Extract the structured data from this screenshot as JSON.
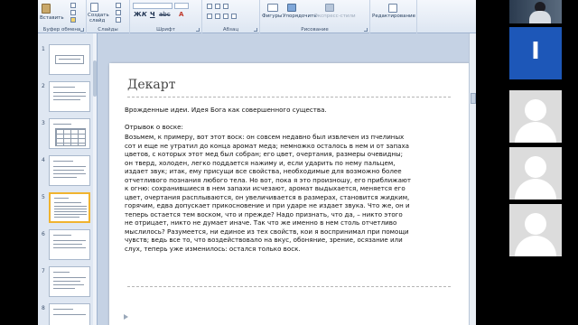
{
  "ribbon": {
    "clipboard": {
      "paste": "Вставить",
      "label": "Буфер обмена"
    },
    "slides": {
      "create": "Создать",
      "create2": "слайд",
      "label": "Слайды"
    },
    "font": {
      "label": "Шрифт"
    },
    "paragraph": {
      "label": "Абзац"
    },
    "drawing": {
      "shapes": "Фигуры",
      "arrange": "Упорядочить",
      "quick_styles": "Экспресс-стили",
      "label": "Рисование"
    },
    "editing": {
      "label": "Редактирование"
    }
  },
  "thumbnails": [
    {
      "num": "1"
    },
    {
      "num": "2"
    },
    {
      "num": "3"
    },
    {
      "num": "4"
    },
    {
      "num": "5"
    },
    {
      "num": "6"
    },
    {
      "num": "7"
    },
    {
      "num": "8"
    }
  ],
  "selected_slide": "5",
  "slide": {
    "title": "Декарт",
    "subtitle": "Врожденные идеи. Идея Бога как совершенного существа.",
    "excerpt_label": "Отрывок о воске:",
    "body": "Возьмем, к примеру, вот этот воск: он совсем недавно был извлечен из пчелиных сот и еще не утратил до конца аромат меда; немножко осталось в нем и от запаха цветов, с которых этот мед был собран; его цвет, очертания, размеры очевидны; он тверд, холоден, легко поддается нажиму и, если ударить по нему пальцем, издает звук; итак, ему присущи все свойства, необходимые для возможно более отчетливого познания любого тела. Но вот, пока я это произношу, его приближают к огню: сохранившиеся в нем запахи исчезают, аромат выдыхается, меняется его цвет, очертания расплываются, он увеличивается в размерах, становится жидким, горячим, едва допускает прикосновение и при ударе не издает звука. Что же, он и теперь остается тем воском, что и прежде? Надо признать, что да, – никто этого не отрицает, никто не думает иначе. Так что же именно в нем столь отчетливо мыслилось? Разумеется, ни единое из тех свойств, кои я воспринимал при помощи чувств; ведь все то, что воздействовало на вкус, обоняние, зрение, осязание или слух, теперь уже изменилось: остался только воск."
  },
  "participants": {
    "initial": "I"
  },
  "colors": {
    "initial_tile": "#1d57b8",
    "selected_thumb": "#f0b32f"
  }
}
